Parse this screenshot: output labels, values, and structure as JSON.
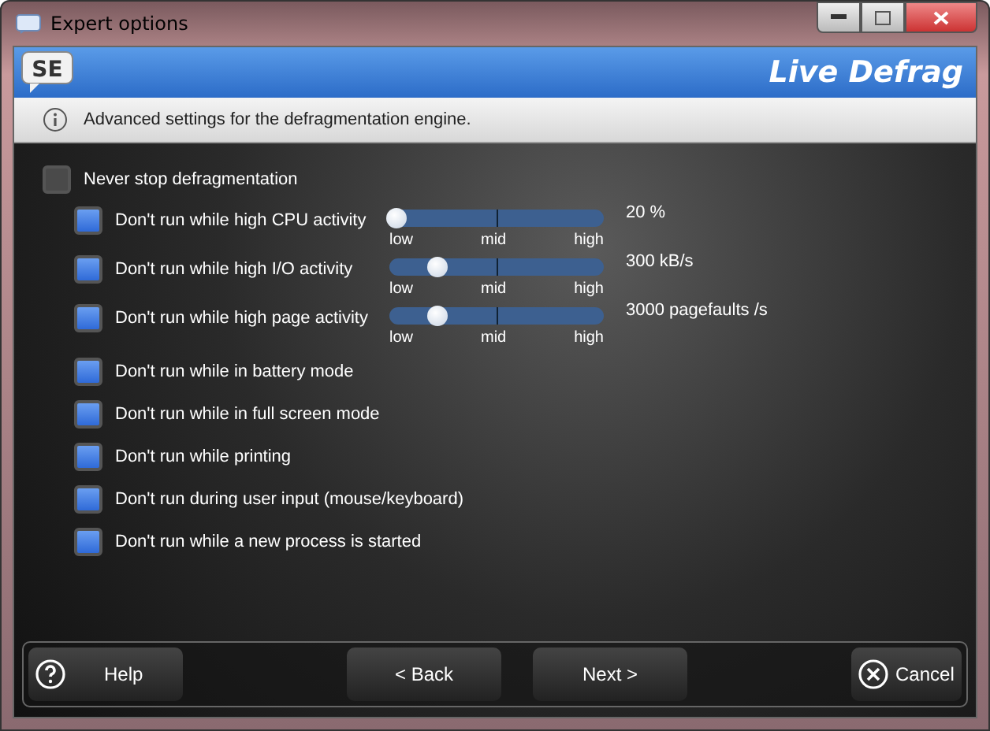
{
  "window": {
    "title": "Expert options"
  },
  "banner": {
    "logo": "SE",
    "title": "Live Defrag"
  },
  "info": {
    "text": "Advanced settings for the defragmentation engine."
  },
  "master_option": {
    "label": "Never stop defragmentation",
    "checked": false
  },
  "options": [
    {
      "label": "Don't run while high CPU activity",
      "checked": true,
      "slider": {
        "level": 0.0,
        "reading": "20 %",
        "ticks": [
          "low",
          "mid",
          "high"
        ]
      }
    },
    {
      "label": "Don't run while high I/O activity",
      "checked": true,
      "slider": {
        "level": 0.2,
        "reading": "300 kB/s",
        "ticks": [
          "low",
          "mid",
          "high"
        ]
      }
    },
    {
      "label": "Don't run while high page activity",
      "checked": true,
      "slider": {
        "level": 0.2,
        "reading": "3000 pagefaults /s",
        "ticks": [
          "low",
          "mid",
          "high"
        ]
      }
    },
    {
      "label": "Don't run while in battery mode",
      "checked": true
    },
    {
      "label": "Don't run while in full screen mode",
      "checked": true
    },
    {
      "label": "Don't run while printing",
      "checked": true
    },
    {
      "label": "Don't run during user input (mouse/keyboard)",
      "checked": true
    },
    {
      "label": "Don't run while a new process is started",
      "checked": true
    }
  ],
  "buttons": [
    {
      "label": "Help",
      "kind": "help"
    },
    {
      "label": "< Back",
      "kind": "plain"
    },
    {
      "label": "Next >",
      "kind": "plain"
    },
    {
      "label": "Cancel",
      "kind": "cancel"
    }
  ]
}
